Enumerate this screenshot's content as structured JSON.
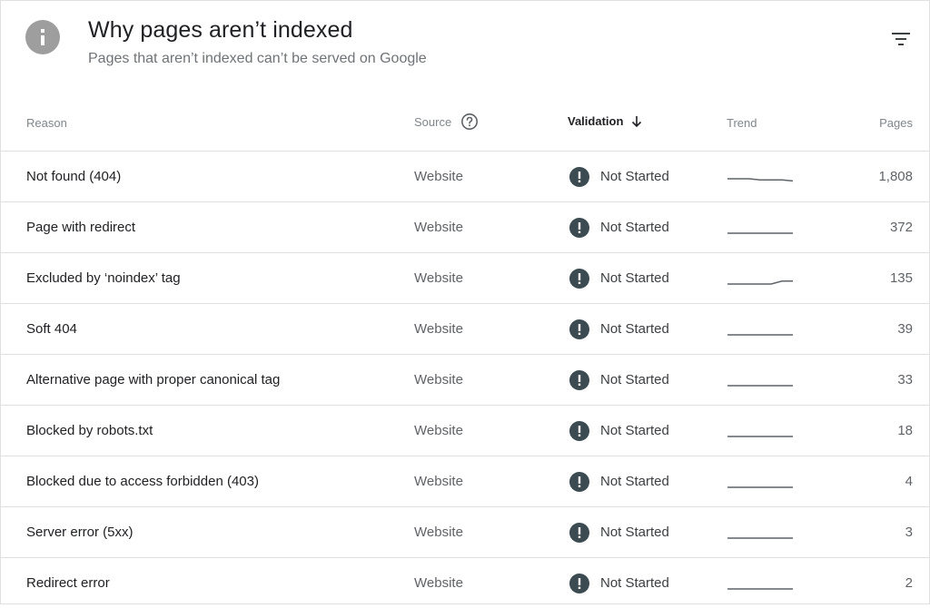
{
  "header": {
    "title": "Why pages aren’t indexed",
    "subtitle": "Pages that aren’t indexed can’t be served on Google"
  },
  "columns": {
    "reason": "Reason",
    "source": "Source",
    "validation": "Validation",
    "trend": "Trend",
    "pages": "Pages"
  },
  "rows": [
    {
      "reason": "Not found (404)",
      "source": "Website",
      "validation": "Not Started",
      "pages": "1,808",
      "trend": [
        1,
        1,
        1,
        0.7,
        0.7,
        0.7,
        0.4
      ]
    },
    {
      "reason": "Page with redirect",
      "source": "Website",
      "validation": "Not Started",
      "pages": "372",
      "trend": [
        0,
        0,
        0,
        0,
        0,
        0,
        0
      ]
    },
    {
      "reason": "Excluded by ‘noindex’ tag",
      "source": "Website",
      "validation": "Not Started",
      "pages": "135",
      "trend": [
        0,
        0,
        0,
        0,
        0,
        0.8,
        0.8
      ]
    },
    {
      "reason": "Soft 404",
      "source": "Website",
      "validation": "Not Started",
      "pages": "39",
      "trend": [
        0,
        0,
        0,
        0,
        0,
        0,
        0
      ]
    },
    {
      "reason": "Alternative page with proper canonical tag",
      "source": "Website",
      "validation": "Not Started",
      "pages": "33",
      "trend": [
        0,
        0,
        0,
        0,
        0,
        0,
        0
      ]
    },
    {
      "reason": "Blocked by robots.txt",
      "source": "Website",
      "validation": "Not Started",
      "pages": "18",
      "trend": [
        0,
        0,
        0,
        0,
        0,
        0,
        0
      ]
    },
    {
      "reason": "Blocked due to access forbidden (403)",
      "source": "Website",
      "validation": "Not Started",
      "pages": "4",
      "trend": [
        0,
        0,
        0,
        0,
        0,
        0,
        0
      ]
    },
    {
      "reason": "Server error (5xx)",
      "source": "Website",
      "validation": "Not Started",
      "pages": "3",
      "trend": [
        0,
        0,
        0,
        0,
        0,
        0,
        0
      ]
    },
    {
      "reason": "Redirect error",
      "source": "Website",
      "validation": "Not Started",
      "pages": "2",
      "trend": [
        0,
        0,
        0,
        0,
        0,
        0,
        0
      ]
    }
  ],
  "icons": {
    "header": "info-icon",
    "filter": "filter-icon",
    "source_help": "help-circle-icon",
    "sort": "arrow-down-icon",
    "status": "exclamation-circle-icon"
  },
  "colors": {
    "info_icon": "#9e9e9e",
    "status_icon": "#3c4a52",
    "trend_line": "#5f6368"
  }
}
